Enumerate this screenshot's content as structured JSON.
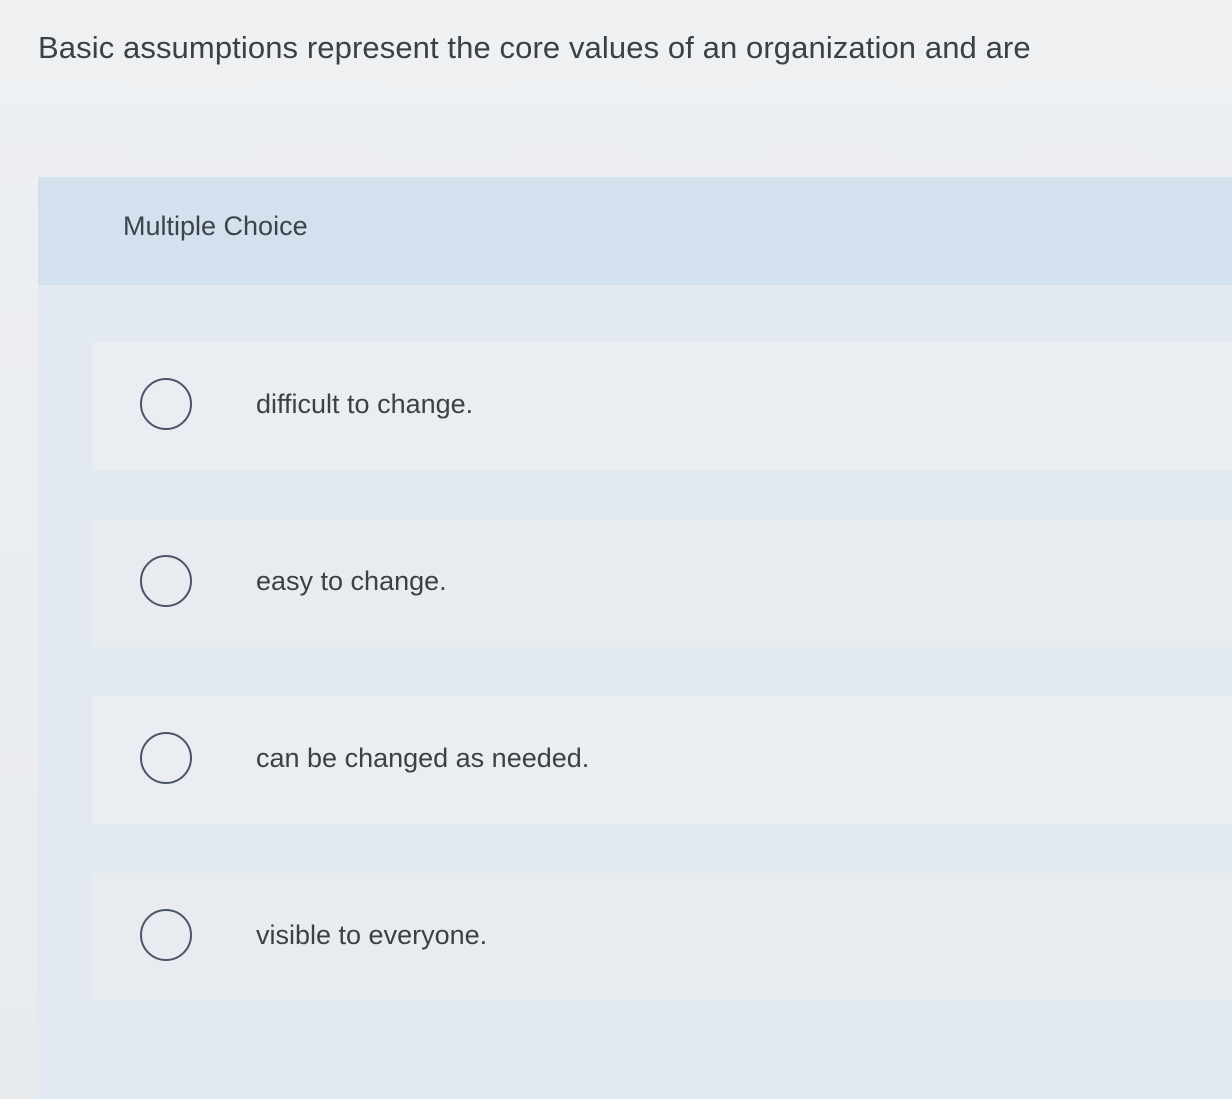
{
  "question": {
    "text": "Basic assumptions represent the core values of an organization and are"
  },
  "multiple_choice": {
    "label": "Multiple Choice",
    "options": [
      {
        "text": "difficult to change.",
        "selected": false
      },
      {
        "text": "easy to change.",
        "selected": false
      },
      {
        "text": "can be changed as needed.",
        "selected": false
      },
      {
        "text": "visible to everyone.",
        "selected": false
      }
    ]
  }
}
